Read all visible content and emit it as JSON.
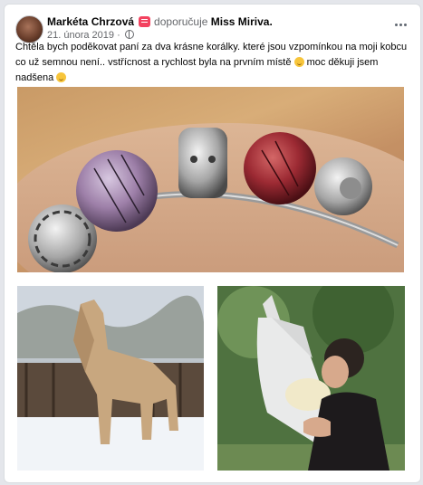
{
  "post": {
    "author": "Markéta Chrzová",
    "action": "doporučuje",
    "target": "Miss Miriva.",
    "date": "21. února 2019 ·",
    "text_part1": "Chtěla bych poděkovat paní za dva krásne korálky. které jsou vzpomínkou na moji kobcu co už semnou není.. vstřícnost a rychlost byla na prvním místě",
    "text_part2": "moc děkuji jsem nadšena"
  },
  "icons": {
    "recommend": "recommend-icon",
    "privacy": "globe-icon",
    "more": "more-options-icon",
    "emoji": "smile-emoji"
  },
  "colors": {
    "author": "#050505",
    "secondary_text": "#65676b",
    "recommend_icon": "#f3425f",
    "card_bg": "#ffffff",
    "page_bg": "#e4e6eb"
  },
  "photos": [
    {
      "name": "photo-bracelet"
    },
    {
      "name": "photo-horse"
    },
    {
      "name": "photo-girl-with-horse"
    }
  ]
}
